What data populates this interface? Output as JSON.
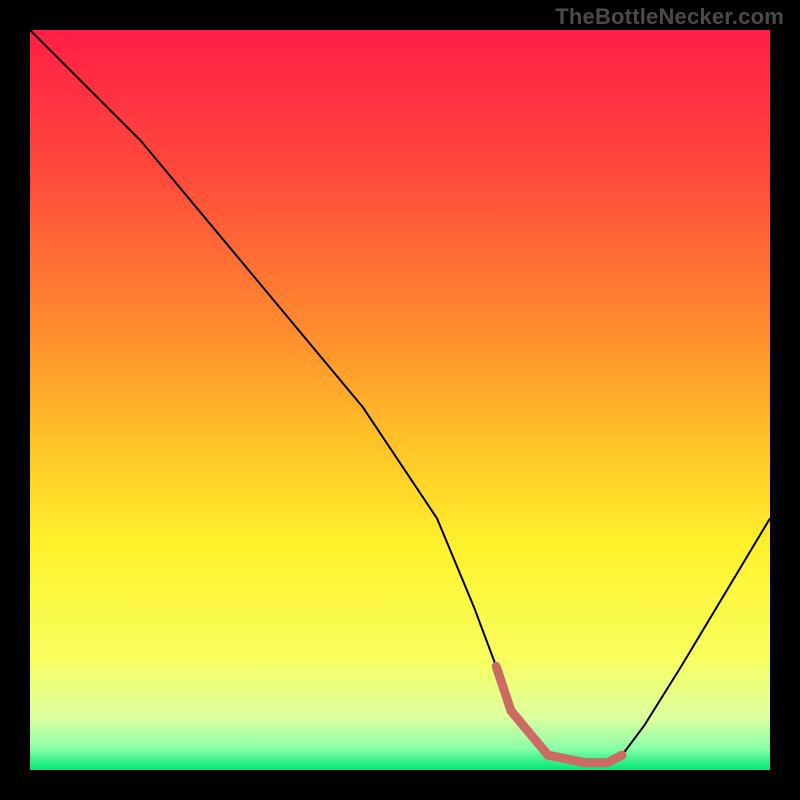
{
  "watermark": "TheBottleNecker.com",
  "chart_data": {
    "type": "line",
    "title": "",
    "xlabel": "",
    "ylabel": "",
    "xlim": [
      0,
      100
    ],
    "ylim": [
      0,
      100
    ],
    "background_gradient": {
      "stops": [
        {
          "offset": 0.0,
          "color": "#ff1e46"
        },
        {
          "offset": 0.2,
          "color": "#ff4b3b"
        },
        {
          "offset": 0.4,
          "color": "#ff8a2f"
        },
        {
          "offset": 0.55,
          "color": "#ffc028"
        },
        {
          "offset": 0.7,
          "color": "#fff22c"
        },
        {
          "offset": 0.85,
          "color": "#f8ff60"
        },
        {
          "offset": 0.93,
          "color": "#dcffa0"
        },
        {
          "offset": 0.97,
          "color": "#8cffa8"
        },
        {
          "offset": 1.0,
          "color": "#00e676"
        }
      ]
    },
    "series": [
      {
        "name": "bottleneck-curve",
        "color": "#000000",
        "x": [
          0,
          3,
          8,
          15,
          25,
          35,
          45,
          55,
          60,
          63,
          65,
          70,
          75,
          78,
          80,
          83,
          88,
          94,
          100
        ],
        "values": [
          100,
          97,
          92,
          85,
          73,
          61,
          49,
          34,
          22,
          14,
          8,
          2,
          1,
          1,
          2,
          6,
          14,
          24,
          34
        ]
      }
    ],
    "highlight_segment": {
      "name": "optimal-range",
      "color": "#cc6b63",
      "x": [
        63,
        65,
        70,
        75,
        78,
        80
      ],
      "values": [
        14,
        8,
        2,
        1,
        1,
        2
      ]
    }
  }
}
